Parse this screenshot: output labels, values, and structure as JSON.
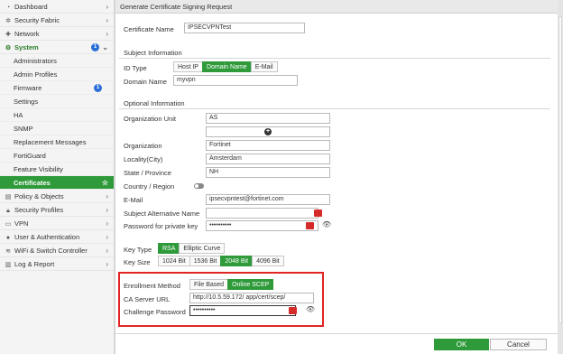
{
  "sidebar": {
    "dashboard": "Dashboard",
    "security_fabric": "Security Fabric",
    "network": "Network",
    "system": "System",
    "system_badge": "1",
    "system_items": {
      "administrators": "Administrators",
      "admin_profiles": "Admin Profiles",
      "firmware": "Firmware",
      "firmware_badge": "1",
      "settings": "Settings",
      "ha": "HA",
      "snmp": "SNMP",
      "replacement_messages": "Replacement Messages",
      "fortiguard": "FortiGuard",
      "feature_visibility": "Feature Visibility",
      "certificates": "Certificates"
    },
    "policy_objects": "Policy & Objects",
    "security_profiles": "Security Profiles",
    "vpn": "VPN",
    "user_auth": "User & Authentication",
    "wifi_switch": "WiFi & Switch Controller",
    "log_report": "Log & Report"
  },
  "dialog": {
    "title": "Generate Certificate Signing Request",
    "certificate_name_label": "Certificate Name",
    "certificate_name_value": "IPSECVPNTest",
    "subject_info_title": "Subject Information",
    "id_type_label": "ID Type",
    "id_type_options": [
      "Host IP",
      "Domain Name",
      "E-Mail"
    ],
    "id_type_selected": "Domain Name",
    "domain_name_label": "Domain Name",
    "domain_name_value": "myvpn",
    "optional_info_title": "Optional Information",
    "org_unit_label": "Organization Unit",
    "org_unit_value": "AS",
    "org_label": "Organization",
    "org_value": "Fortinet",
    "locality_label": "Locality(City)",
    "locality_value": "Amsterdam",
    "state_label": "State / Province",
    "state_value": "NH",
    "country_label": "Country / Region",
    "email_label": "E-Mail",
    "email_value": "ipsecvpntest@fortinet.com",
    "san_label": "Subject Alternative Name",
    "san_value": "",
    "private_key_pw_label": "Password for private key",
    "private_key_pw_value": "••••••••••",
    "key_type_label": "Key Type",
    "key_type_options": [
      "RSA",
      "Elliptic Curve"
    ],
    "key_type_selected": "RSA",
    "key_size_label": "Key Size",
    "key_size_options": [
      "1024 Bit",
      "1536 Bit",
      "2048 Bit",
      "4096 Bit"
    ],
    "key_size_selected": "2048 Bit",
    "enrollment_method_label": "Enrollment Method",
    "enrollment_options": [
      "File Based",
      "Online SCEP"
    ],
    "enrollment_selected": "Online SCEP",
    "ca_server_url_label": "CA Server URL",
    "ca_server_url_value": "http://10.5.59.172/ app/cert/scep/",
    "challenge_pw_label": "Challenge Password",
    "challenge_pw_value": "••••••••••"
  },
  "buttons": {
    "ok": "OK",
    "cancel": "Cancel"
  },
  "colors": {
    "accent_green": "#2f9a3a",
    "highlight_red": "#e02424",
    "badge_blue": "#2b6fd6"
  }
}
